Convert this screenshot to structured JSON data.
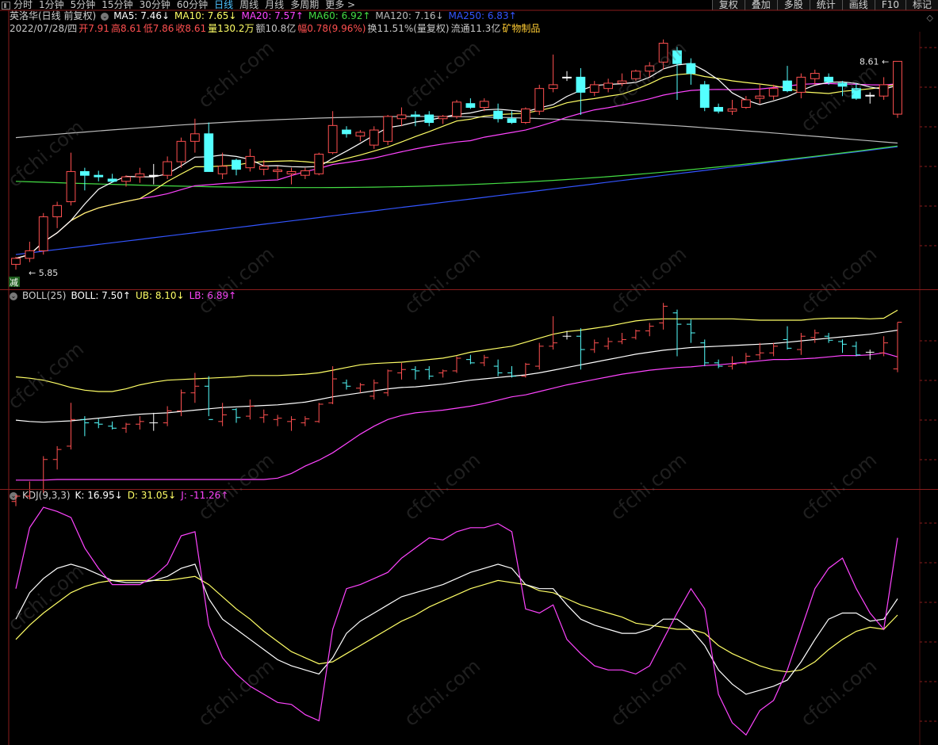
{
  "toolbar": {
    "periods": [
      "分时",
      "1分钟",
      "5分钟",
      "15分钟",
      "30分钟",
      "60分钟",
      "日线",
      "周线",
      "月线",
      "多周期",
      "更多 >"
    ],
    "active_period": "日线",
    "right_buttons": [
      "复权",
      "叠加",
      "多股",
      "统计",
      "画线",
      "F10",
      "标记"
    ]
  },
  "header": {
    "stock_name": "英洛华(日线 前复权)",
    "ma5": "MA5: 7.46↓",
    "ma10": "MA10: 7.65↓",
    "ma20": "MA20: 7.57↑",
    "ma60": "MA60: 6.92↑",
    "ma120": "MA120: 7.16↓",
    "ma250": "MA250: 6.83↑",
    "date": "2022/07/28/四",
    "open": "开7.91",
    "high": "高8.61",
    "low": "低7.86",
    "close": "收8.61",
    "volume": "量130.2万",
    "amount": "额10.8亿",
    "change": "幅0.78(9.96%)",
    "turnover": "换11.51%(量复权)",
    "float": "流通11.3亿",
    "industry": "矿物制品"
  },
  "main_labels": {
    "high_mark": "8.61",
    "low_mark": "5.85",
    "reduce_tag": "减"
  },
  "boll": {
    "name": "BOLL(25)",
    "boll": "BOLL: 7.50↑",
    "ub": "UB: 8.10↓",
    "lb": "LB: 6.89↑"
  },
  "kdj": {
    "name": "KDJ(9,3,3)",
    "k": "K: 16.95↓",
    "d": "D: 31.05↓",
    "j": "J: -11.26↑"
  },
  "watermark": "cfchi.com",
  "colors": {
    "up": "#ff5050",
    "down": "#54ffff",
    "ma5": "#ffffff",
    "ma10": "#ffff66",
    "ma20": "#ff44ff",
    "ma60": "#44dd44",
    "ma120": "#bbbbbb",
    "ma250": "#3355ff",
    "grid": "#8a1d1d"
  },
  "chart_data": {
    "type": "candlestick",
    "ohlc": [
      [
        5.92,
        6.02,
        5.85,
        6.0
      ],
      [
        6.0,
        6.22,
        5.95,
        6.1
      ],
      [
        6.1,
        6.6,
        6.05,
        6.55
      ],
      [
        6.55,
        6.75,
        6.4,
        6.7
      ],
      [
        6.75,
        7.4,
        6.7,
        7.15
      ],
      [
        7.15,
        7.2,
        6.9,
        7.1
      ],
      [
        7.1,
        7.16,
        7.02,
        7.08
      ],
      [
        7.05,
        7.12,
        7.0,
        7.02
      ],
      [
        7.02,
        7.1,
        6.95,
        7.08
      ],
      [
        7.08,
        7.2,
        7.0,
        7.12
      ],
      [
        7.1,
        7.25,
        6.98,
        7.1
      ],
      [
        7.1,
        7.35,
        7.05,
        7.28
      ],
      [
        7.28,
        7.6,
        7.2,
        7.55
      ],
      [
        7.55,
        7.85,
        7.4,
        7.65
      ],
      [
        7.65,
        7.8,
        7.2,
        7.15
      ],
      [
        7.12,
        7.4,
        7.05,
        7.22
      ],
      [
        7.3,
        7.32,
        7.1,
        7.18
      ],
      [
        7.2,
        7.45,
        7.15,
        7.35
      ],
      [
        7.18,
        7.3,
        7.1,
        7.22
      ],
      [
        7.15,
        7.22,
        7.05,
        7.17
      ],
      [
        7.12,
        7.2,
        6.98,
        7.15
      ],
      [
        7.1,
        7.2,
        7.05,
        7.16
      ],
      [
        7.12,
        7.4,
        7.1,
        7.38
      ],
      [
        7.4,
        7.95,
        7.38,
        7.76
      ],
      [
        7.7,
        7.75,
        7.6,
        7.65
      ],
      [
        7.62,
        7.7,
        7.55,
        7.67
      ],
      [
        7.5,
        7.75,
        7.45,
        7.7
      ],
      [
        7.55,
        7.9,
        7.5,
        7.88
      ],
      [
        7.85,
        8.0,
        7.75,
        7.9
      ],
      [
        7.9,
        7.95,
        7.75,
        7.88
      ],
      [
        7.9,
        7.95,
        7.75,
        7.8
      ],
      [
        7.85,
        7.9,
        7.78,
        7.88
      ],
      [
        7.88,
        8.1,
        7.85,
        8.07
      ],
      [
        8.05,
        8.12,
        7.98,
        8.0
      ],
      [
        8.0,
        8.12,
        7.95,
        8.08
      ],
      [
        7.95,
        8.05,
        7.8,
        7.85
      ],
      [
        7.85,
        7.95,
        7.78,
        7.8
      ],
      [
        7.8,
        8.0,
        7.78,
        7.98
      ],
      [
        7.95,
        8.3,
        7.9,
        8.25
      ],
      [
        8.25,
        8.7,
        8.2,
        8.3
      ],
      [
        8.4,
        8.48,
        8.35,
        8.4
      ],
      [
        8.4,
        8.52,
        7.9,
        8.2
      ],
      [
        8.2,
        8.35,
        8.15,
        8.3
      ],
      [
        8.25,
        8.38,
        8.2,
        8.32
      ],
      [
        8.32,
        8.45,
        8.28,
        8.35
      ],
      [
        8.38,
        8.5,
        8.35,
        8.48
      ],
      [
        8.48,
        8.6,
        8.4,
        8.55
      ],
      [
        8.6,
        8.9,
        8.5,
        8.85
      ],
      [
        8.75,
        8.8,
        8.1,
        8.58
      ],
      [
        8.58,
        8.65,
        8.3,
        8.45
      ],
      [
        8.3,
        8.35,
        7.95,
        8.0
      ],
      [
        8.0,
        8.05,
        7.92,
        7.95
      ],
      [
        7.95,
        8.1,
        7.9,
        7.98
      ],
      [
        8.0,
        8.15,
        7.98,
        8.1
      ],
      [
        8.12,
        8.3,
        8.05,
        8.15
      ],
      [
        8.15,
        8.3,
        8.1,
        8.25
      ],
      [
        8.35,
        8.55,
        8.2,
        8.22
      ],
      [
        8.2,
        8.45,
        8.12,
        8.4
      ],
      [
        8.38,
        8.5,
        8.3,
        8.45
      ],
      [
        8.4,
        8.45,
        8.3,
        8.34
      ],
      [
        8.32,
        8.35,
        8.15,
        8.28
      ],
      [
        8.25,
        8.32,
        8.1,
        8.12
      ],
      [
        8.16,
        8.2,
        8.05,
        8.16
      ],
      [
        8.15,
        8.4,
        8.1,
        8.3
      ],
      [
        7.91,
        8.61,
        7.86,
        8.61
      ]
    ],
    "ylim_main": [
      5.8,
      8.95
    ],
    "boll": {
      "mid": [
        6.95,
        6.93,
        6.92,
        6.93,
        6.94,
        6.96,
        6.98,
        7.0,
        7.02,
        7.04,
        7.05,
        7.06,
        7.08,
        7.1,
        7.12,
        7.14,
        7.15,
        7.16,
        7.17,
        7.18,
        7.2,
        7.22,
        7.26,
        7.3,
        7.33,
        7.36,
        7.39,
        7.42,
        7.44,
        7.45,
        7.47,
        7.49,
        7.52,
        7.55,
        7.57,
        7.59,
        7.61,
        7.63,
        7.66,
        7.7,
        7.74,
        7.78,
        7.82,
        7.86,
        7.9,
        7.94,
        7.97,
        8.0,
        8.02,
        8.04,
        8.05,
        8.06,
        8.07,
        8.08,
        8.09,
        8.1,
        8.12,
        8.14,
        8.16,
        8.18,
        8.2,
        8.22,
        8.24,
        8.27,
        8.3
      ],
      "ub": [
        7.6,
        7.58,
        7.55,
        7.5,
        7.44,
        7.4,
        7.38,
        7.38,
        7.42,
        7.48,
        7.52,
        7.55,
        7.56,
        7.57,
        7.58,
        7.59,
        7.6,
        7.62,
        7.62,
        7.62,
        7.63,
        7.64,
        7.66,
        7.7,
        7.74,
        7.78,
        7.8,
        7.81,
        7.82,
        7.84,
        7.86,
        7.88,
        7.92,
        7.97,
        8.0,
        8.03,
        8.06,
        8.12,
        8.18,
        8.24,
        8.28,
        8.3,
        8.33,
        8.36,
        8.4,
        8.44,
        8.46,
        8.47,
        8.47,
        8.47,
        8.47,
        8.47,
        8.47,
        8.46,
        8.45,
        8.45,
        8.45,
        8.45,
        8.47,
        8.48,
        8.48,
        8.48,
        8.47,
        8.48,
        8.6
      ],
      "lb": [
        6.05,
        6.05,
        6.05,
        6.06,
        6.06,
        6.06,
        6.06,
        6.06,
        6.06,
        6.06,
        6.06,
        6.06,
        6.06,
        6.06,
        6.06,
        6.06,
        6.06,
        6.06,
        6.06,
        6.08,
        6.15,
        6.26,
        6.35,
        6.46,
        6.6,
        6.74,
        6.86,
        6.96,
        7.02,
        7.06,
        7.08,
        7.1,
        7.13,
        7.16,
        7.2,
        7.25,
        7.3,
        7.33,
        7.38,
        7.43,
        7.48,
        7.52,
        7.56,
        7.6,
        7.64,
        7.67,
        7.7,
        7.72,
        7.74,
        7.75,
        7.77,
        7.78,
        7.8,
        7.82,
        7.84,
        7.86,
        7.86,
        7.87,
        7.88,
        7.9,
        7.92,
        7.92,
        7.93,
        7.96,
        7.9
      ]
    },
    "kdj": {
      "k": [
        45,
        58,
        65,
        70,
        72,
        70,
        67,
        64,
        63,
        63,
        64,
        66,
        70,
        72,
        55,
        45,
        40,
        35,
        30,
        25,
        22,
        20,
        18,
        26,
        38,
        44,
        48,
        52,
        56,
        58,
        60,
        62,
        65,
        68,
        70,
        72,
        70,
        62,
        60,
        60,
        52,
        45,
        42,
        40,
        38,
        38,
        40,
        45,
        45,
        40,
        32,
        20,
        13,
        8,
        10,
        12,
        15,
        24,
        35,
        45,
        48,
        48,
        44,
        45,
        55
      ],
      "d": [
        35,
        42,
        48,
        53,
        58,
        61,
        63,
        64,
        64,
        64,
        64,
        64,
        65,
        66,
        62,
        56,
        50,
        45,
        39,
        34,
        29,
        26,
        23,
        24,
        28,
        32,
        36,
        40,
        44,
        47,
        51,
        54,
        57,
        60,
        62,
        64,
        63,
        62,
        59,
        58,
        55,
        52,
        50,
        48,
        46,
        43,
        42,
        41,
        40,
        40,
        38,
        32,
        28,
        25,
        22,
        20,
        19,
        20,
        24,
        30,
        35,
        39,
        41,
        40,
        47
      ],
      "j": [
        60,
        90,
        100,
        98,
        95,
        80,
        70,
        62,
        62,
        62,
        66,
        72,
        86,
        88,
        42,
        26,
        18,
        12,
        8,
        4,
        3,
        -2,
        -5,
        40,
        60,
        62,
        65,
        68,
        75,
        80,
        85,
        84,
        88,
        90,
        90,
        92,
        88,
        50,
        48,
        52,
        35,
        28,
        22,
        20,
        20,
        18,
        22,
        35,
        48,
        60,
        50,
        8,
        -6,
        -12,
        0,
        5,
        20,
        40,
        60,
        70,
        75,
        60,
        48,
        40,
        85
      ]
    }
  }
}
